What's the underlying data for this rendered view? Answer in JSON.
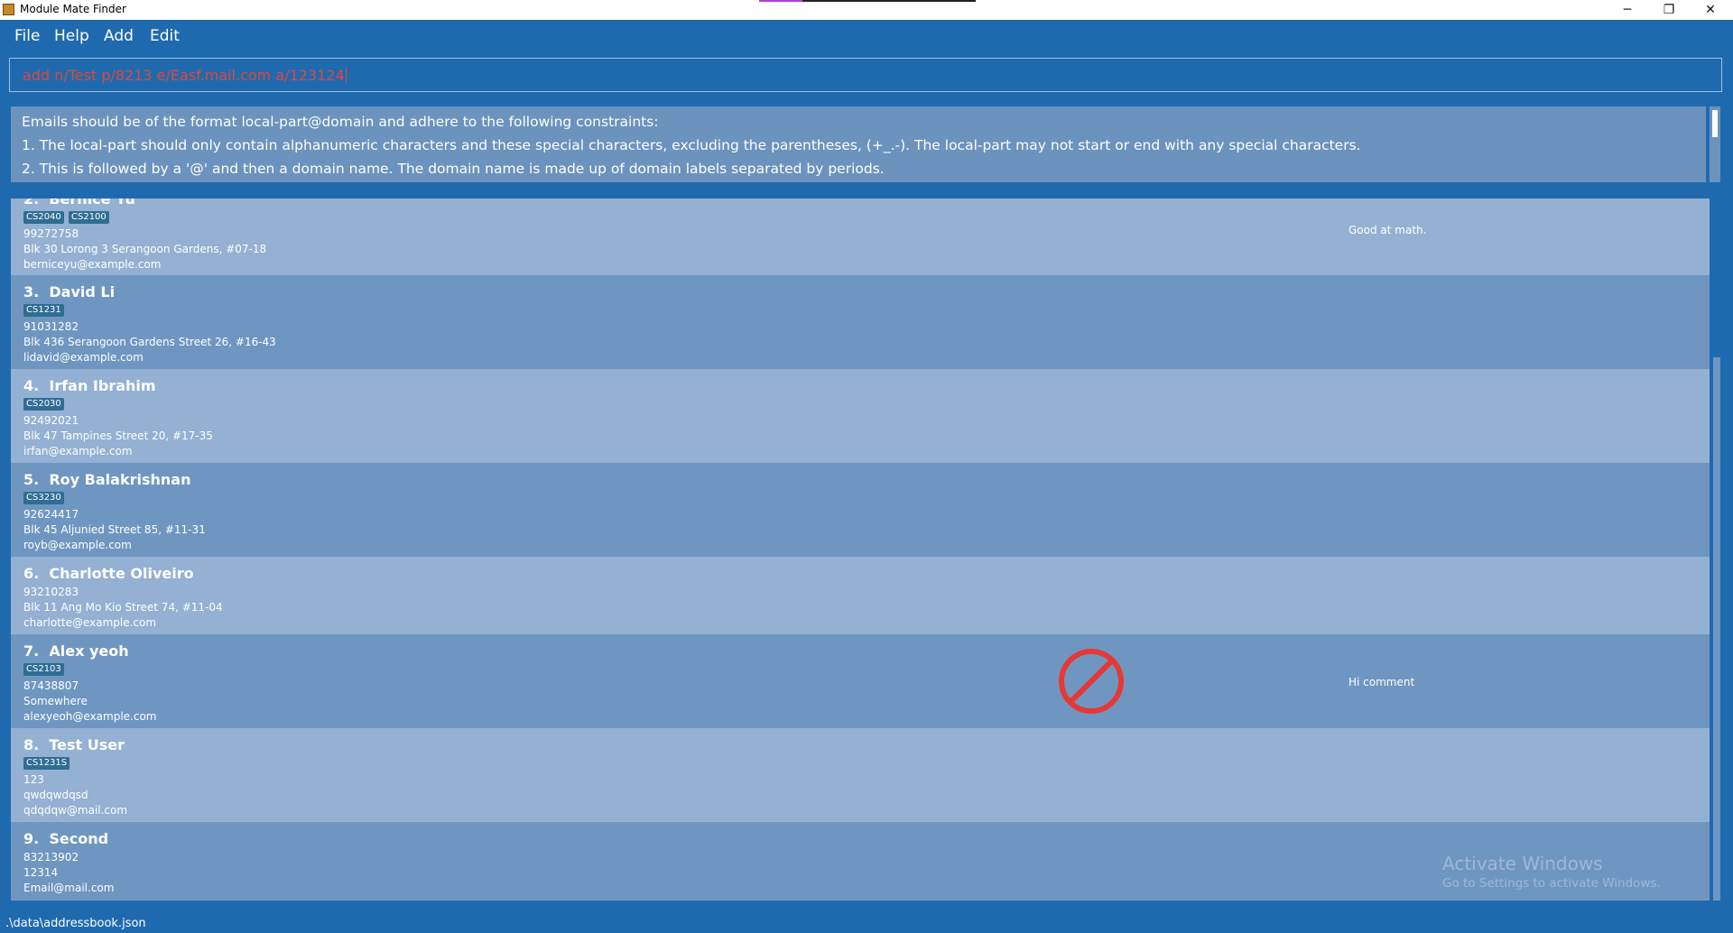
{
  "window": {
    "title": "Module Mate Finder",
    "minimize_glyph": "─",
    "maximize_glyph": "❐",
    "close_glyph": "✕"
  },
  "menu": {
    "items": [
      "File",
      "Help",
      "Add",
      "Edit"
    ]
  },
  "command": {
    "value": "add n/Test p/8213 e/Easf.mail.com a/123124"
  },
  "result": {
    "lines": [
      "Emails should be of the format local-part@domain and adhere to the following constraints:",
      "1. The local-part should only contain alphanumeric characters and these special characters, excluding the parentheses, (+_.-). The local-part may not start or end with any special characters.",
      "2. This is followed by a '@' and then a domain name. The domain name is made up of domain labels separated by periods."
    ]
  },
  "persons": [
    {
      "index": "2.",
      "name": "Bernice Yu",
      "tags": [
        "CS2040",
        "CS2100"
      ],
      "phone": "99272758",
      "address": "Blk 30 Lorong 3 Serangoon Gardens, #07-18",
      "email": "berniceyu@example.com",
      "comment": "Good at math."
    },
    {
      "index": "3.",
      "name": "David Li",
      "tags": [
        "CS1231"
      ],
      "phone": "91031282",
      "address": "Blk 436 Serangoon Gardens Street 26, #16-43",
      "email": "lidavid@example.com",
      "comment": ""
    },
    {
      "index": "4.",
      "name": "Irfan Ibrahim",
      "tags": [
        "CS2030"
      ],
      "phone": "92492021",
      "address": "Blk 47 Tampines Street 20, #17-35",
      "email": "irfan@example.com",
      "comment": ""
    },
    {
      "index": "5.",
      "name": "Roy Balakrishnan",
      "tags": [
        "CS3230"
      ],
      "phone": "92624417",
      "address": "Blk 45 Aljunied Street 85, #11-31",
      "email": "royb@example.com",
      "comment": ""
    },
    {
      "index": "6.",
      "name": "Charlotte Oliveiro",
      "tags": [],
      "phone": "93210283",
      "address": "Blk 11 Ang Mo Kio Street 74, #11-04",
      "email": "charlotte@example.com",
      "comment": ""
    },
    {
      "index": "7.",
      "name": "Alex yeoh",
      "tags": [
        "CS2103"
      ],
      "phone": "87438807",
      "address": "Somewhere",
      "email": "alexyeoh@example.com",
      "comment": "Hi comment"
    },
    {
      "index": "8.",
      "name": "Test User",
      "tags": [
        "CS1231S"
      ],
      "phone": "123",
      "address": "qwdqwdqsd",
      "email": "qdqdqw@mail.com",
      "comment": ""
    },
    {
      "index": "9.",
      "name": "Second",
      "tags": [],
      "phone": "83213902",
      "address": "12314",
      "email": "Email@mail.com",
      "comment": ""
    }
  ],
  "watermark": {
    "title": "Activate Windows",
    "subtitle": "Go to Settings to activate Windows."
  },
  "status": {
    "path": ".\\data\\addressbook.json"
  },
  "icons": {
    "cursor": "no-entry-cursor-icon",
    "cursor_color": "#e53935"
  }
}
